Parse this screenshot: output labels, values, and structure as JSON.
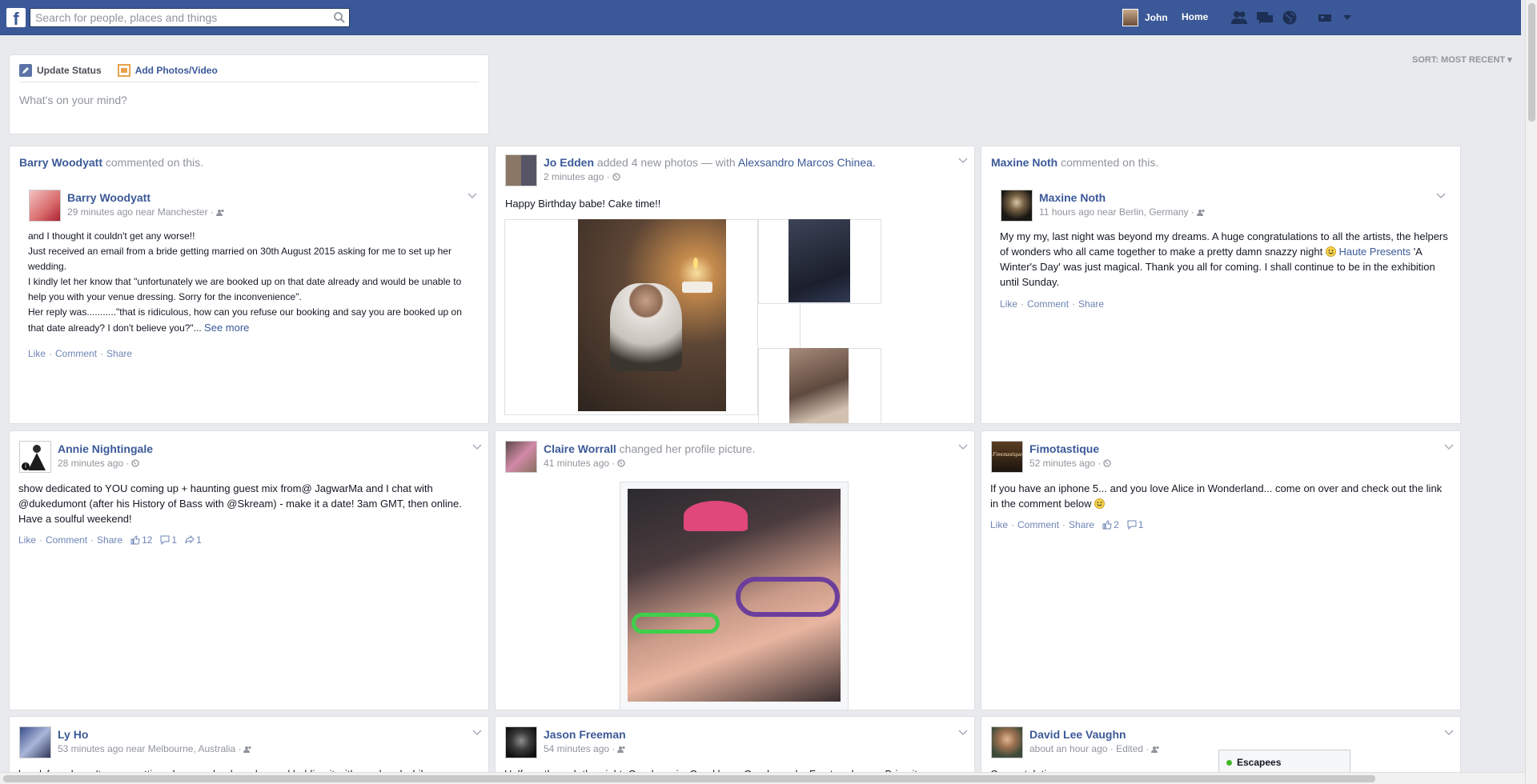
{
  "topbar": {
    "search_placeholder": "Search for people, places and things",
    "user_name": "John",
    "home_label": "Home"
  },
  "composer": {
    "update_status": "Update Status",
    "add_photos": "Add Photos/Video",
    "placeholder": "What's on your mind?"
  },
  "sort_label": "SORT: MOST RECENT",
  "posts": {
    "barry": {
      "story_name": "Barry Woodyatt",
      "story_text": "commented on this.",
      "name": "Barry Woodyatt",
      "meta": "29 minutes ago near Manchester ·",
      "lines": [
        "and I thought it couldn't get any worse!!",
        "Just received an email from a bride getting married on 30th August 2015 asking for me to set up her wedding.",
        "I kindly let her know that \"unfortunately we are booked up on that date already and would be unable to help you with your venue dressing. Sorry for the inconvenience\".",
        "Her reply was...........\"that is ridiculous, how can you refuse our booking and say you are booked up on that date already? I don't believe you?\"..."
      ],
      "see_more": "See more",
      "actions": {
        "like": "Like",
        "comment": "Comment",
        "share": "Share"
      }
    },
    "jo": {
      "name": "Jo Edden",
      "action": "added 4 new photos — with",
      "with": "Alexsandro Marcos Chinea.",
      "meta": "2 minutes ago ·",
      "text": "Happy Birthday babe! Cake time!!"
    },
    "maxine": {
      "story_name": "Maxine Noth",
      "story_text": "commented on this.",
      "name": "Maxine Noth",
      "meta": "11 hours ago near Berlin, Germany ·",
      "text_a": "My my my, last night was beyond my dreams. A huge congratulations to all the artists, the helpers of wonders who all came together to make a pretty damn snazzy night",
      "page_link": "Haute Presents",
      "text_b": "'A Winter's Day' was just magical. Thank you all for coming. I shall continue to be in the exhibition until Sunday.",
      "actions": {
        "like": "Like",
        "comment": "Comment",
        "share": "Share"
      }
    },
    "annie": {
      "name": "Annie Nightingale",
      "meta": "28 minutes ago ·",
      "text": "show dedicated to YOU coming up + haunting guest mix from@ JagwarMa and I chat with @dukedumont (after his History of Bass with @Skream) - make it a date! 3am GMT, then online. Have a soulful weekend!",
      "actions": {
        "like": "Like",
        "comment": "Comment",
        "share": "Share"
      },
      "likes": "12",
      "comments": "1",
      "shares": "1"
    },
    "claire": {
      "name": "Claire Worrall",
      "action": "changed her profile picture.",
      "meta": "41 minutes ago ·"
    },
    "fimo": {
      "name": "Fimotastique",
      "meta": "52 minutes ago ·",
      "text": "If you have an iphone 5... and you love Alice in Wonderland... come on over and check out the link in the comment below",
      "actions": {
        "like": "Like",
        "comment": "Comment",
        "share": "Share"
      },
      "likes": "2",
      "comments": "1"
    },
    "ly": {
      "name": "Ly Ho",
      "meta": "53 minutes ago near Melbourne, Australia ·",
      "text": "handsfree doesn't mean putting phone on loudspeaker and holding it with one hand while"
    },
    "jason": {
      "name": "Jason Freeman",
      "meta": "54 minutes ago ·",
      "text": "Halfway through the night. Good music. Good beer. Good people. Fractured nose. Bring it"
    },
    "david": {
      "name": "David Lee Vaughn",
      "meta": "about an hour ago · Edited ·",
      "text": "Congratulations"
    }
  },
  "chat": {
    "label": "Escapees"
  },
  "colors": {
    "brand": "#3b5998",
    "link": "#3b5998",
    "meta": "#90949c",
    "online": "#42b72a"
  }
}
